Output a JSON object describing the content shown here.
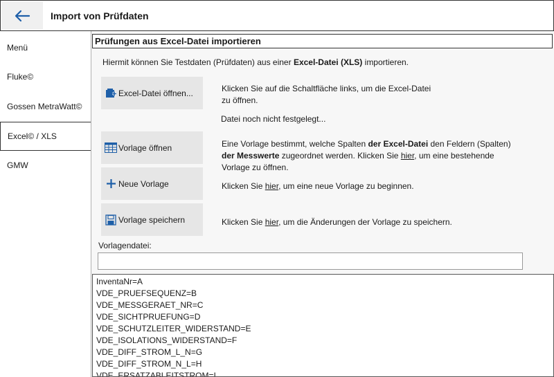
{
  "header": {
    "title": "Import von Prüfdaten",
    "back_icon": "arrow-left-icon"
  },
  "sidebar": {
    "items": [
      {
        "label": "Menü",
        "active": false
      },
      {
        "label": "Fluke©",
        "active": false
      },
      {
        "label": "Gossen MetraWatt©",
        "active": false
      },
      {
        "label": "Excel© / XLS",
        "active": true
      },
      {
        "label": "GMW",
        "active": false
      }
    ]
  },
  "panel": {
    "title": "Prüfungen aus Excel-Datei importieren",
    "intro_pre": "Hiermit können Sie Testdaten (Prüfdaten) aus einer ",
    "intro_bold": "Excel-Datei (XLS)",
    "intro_post": " importieren."
  },
  "actions": {
    "open_excel": {
      "label": "Excel-Datei öffnen...",
      "icon": "add-file-icon",
      "desc_line1": "Klicken Sie auf die Schaltfläche links, um die Excel-Datei",
      "desc_line2": "zu öffnen."
    },
    "file_status": "Datei noch nicht festgelegt...",
    "open_template": {
      "label": "Vorlage öffnen",
      "icon": "table-icon",
      "desc_a": "Eine Vorlage bestimmt, welche Spalten ",
      "desc_b_bold": "der Excel-Datei",
      "desc_c": " den Feldern (Spalten)",
      "desc_d_bold": "der Messwerte",
      "desc_e": " zugeordnet werden. Klicken Sie ",
      "desc_link": "hier",
      "desc_f": ", um eine bestehende",
      "desc_g": "Vorlage zu öffnen."
    },
    "new_template": {
      "label": "Neue Vorlage",
      "icon": "plus-icon",
      "desc_a": "Klicken Sie ",
      "desc_link": "hier",
      "desc_b": ", um eine neue Vorlage zu beginnen."
    },
    "save_template": {
      "label": "Vorlage speichern",
      "icon": "floppy-disk-icon",
      "desc_a": "Klicken Sie ",
      "desc_link": "hier",
      "desc_b": ", um die Änderungen der Vorlage zu speichern."
    }
  },
  "template_file": {
    "label": "Vorlagendatei:",
    "value": ""
  },
  "mapping": [
    "InventaNr=A",
    "VDE_PRUEFSEQUENZ=B",
    "VDE_MESSGERAET_NR=C",
    "VDE_SICHTPRUEFUNG=D",
    "VDE_SCHUTZLEITER_WIDERSTAND=E",
    "VDE_ISOLATIONS_WIDERSTAND=F",
    "VDE_DIFF_STROM_L_N=G",
    "VDE_DIFF_STROM_N_L=H",
    "VDE_ERSATZABLEITSTROM=I"
  ],
  "colors": {
    "accent": "#1e5fa8",
    "button_bg": "#e6e6e6",
    "panel_bg": "#f7f7f7"
  }
}
